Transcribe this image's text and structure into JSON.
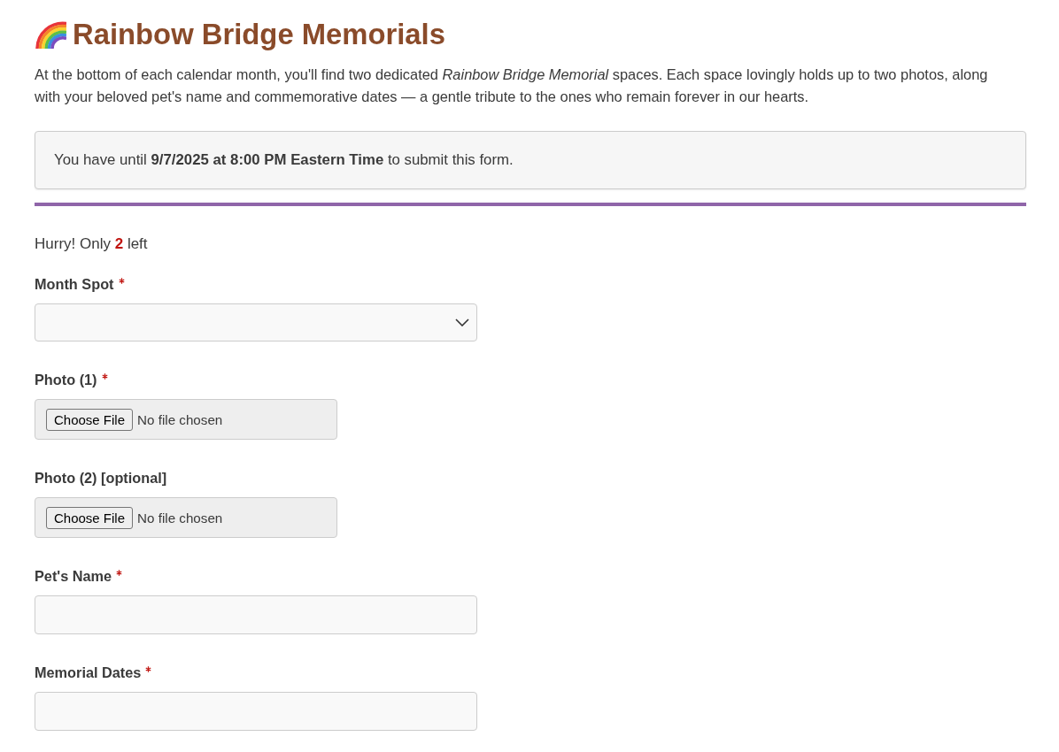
{
  "header": {
    "title": "Rainbow Bridge Memorials"
  },
  "intro": "At the bottom of each calendar month, you'll find two dedicated *Rainbow Bridge Memorial* spaces. Each space lovingly holds up to two photos, along with your beloved pet's name and commemorative dates — a gentle tribute to the ones who remain forever in our hearts.",
  "deadline_notice": "You have until **9/7/2025 at 8:00 PM Eastern Time** to submit this form.",
  "availability": "Hurry! Only **2** left",
  "fields": [
    {
      "kind": "select",
      "label": "Month Spot",
      "required": true
    },
    {
      "kind": "file",
      "label": "Photo (1)",
      "required": true,
      "button": "Choose File",
      "status": "No file chosen"
    },
    {
      "kind": "file",
      "label": "Photo (2) [optional]",
      "required": false,
      "button": "Choose File",
      "status": "No file chosen"
    },
    {
      "kind": "text",
      "label": "Pet's Name",
      "required": true
    },
    {
      "kind": "text",
      "label": "Memorial Dates",
      "required": true
    }
  ]
}
